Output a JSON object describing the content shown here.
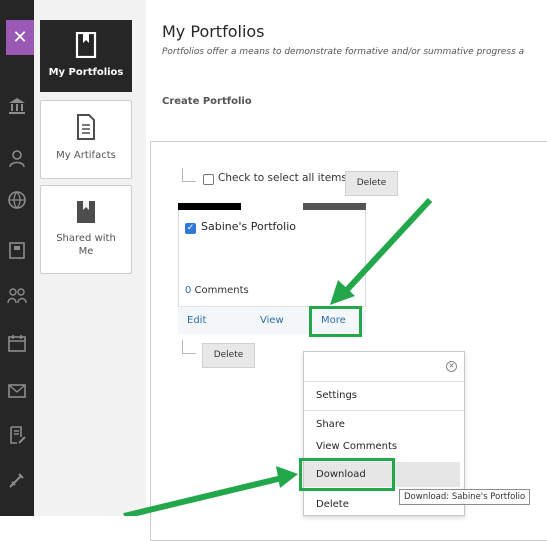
{
  "page": {
    "title": "My Portfolios",
    "subtitle": "Portfolios offer a means to demonstrate formative and/or summative progress a",
    "create_label": "Create Portfolio"
  },
  "subnav": {
    "items": [
      {
        "label": "My Portfolios"
      },
      {
        "label": "My Artifacts"
      },
      {
        "label": "Shared with Me"
      }
    ]
  },
  "list": {
    "select_all_label": "Check to select all items",
    "delete_label": "Delete"
  },
  "card": {
    "title": "Sabine's Portfolio",
    "comments": "0 Comments",
    "edit": "Edit",
    "view": "View",
    "more": "More",
    "bar_colors": [
      "#000000",
      "#ffffff",
      "#555555"
    ]
  },
  "menu": {
    "settings": "Settings",
    "share": "Share",
    "view_comments": "View Comments",
    "download": "Download",
    "delete": "Delete"
  },
  "tooltip": {
    "text": "Download: Sabine's Portfolio"
  },
  "colors": {
    "highlight": "#22a84b",
    "accent_purple": "#9b59b6",
    "link": "#2f6ea8"
  }
}
